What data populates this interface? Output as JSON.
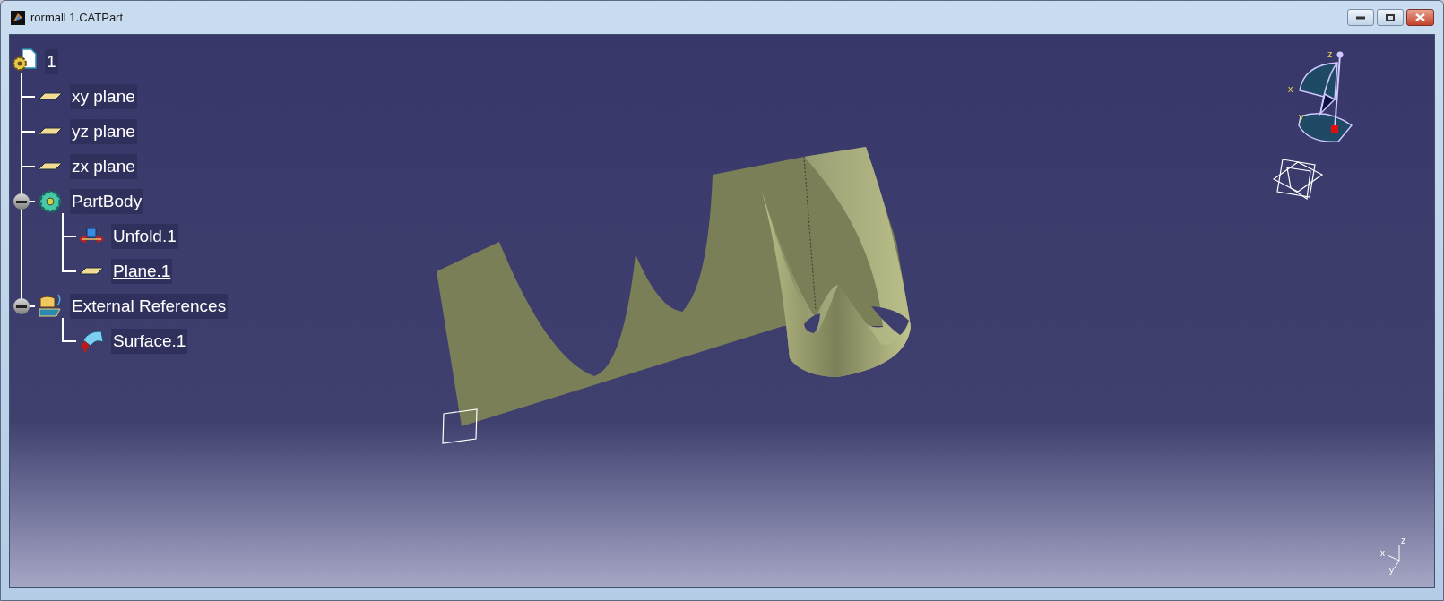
{
  "window": {
    "title": "rormall 1.CATPart"
  },
  "tree": {
    "label": "1",
    "kind": "root",
    "current": false,
    "children": [
      {
        "label": "xy plane",
        "kind": "plane",
        "current": false
      },
      {
        "label": "yz plane",
        "kind": "plane",
        "current": false
      },
      {
        "label": "zx plane",
        "kind": "plane",
        "current": false
      },
      {
        "label": "PartBody",
        "kind": "body",
        "current": false,
        "expanded": true,
        "children": [
          {
            "label": "Unfold.1",
            "kind": "unfold",
            "current": false
          },
          {
            "label": "Plane.1",
            "kind": "plane",
            "current": true
          }
        ]
      },
      {
        "label": "External References",
        "kind": "references",
        "current": false,
        "expanded": true,
        "children": [
          {
            "label": "Surface.1",
            "kind": "surface",
            "current": false
          }
        ]
      }
    ]
  },
  "compass": {
    "labels": [
      "z",
      "x",
      "y"
    ]
  },
  "axis_triad": {
    "labels": [
      "z",
      "x",
      "y"
    ]
  }
}
